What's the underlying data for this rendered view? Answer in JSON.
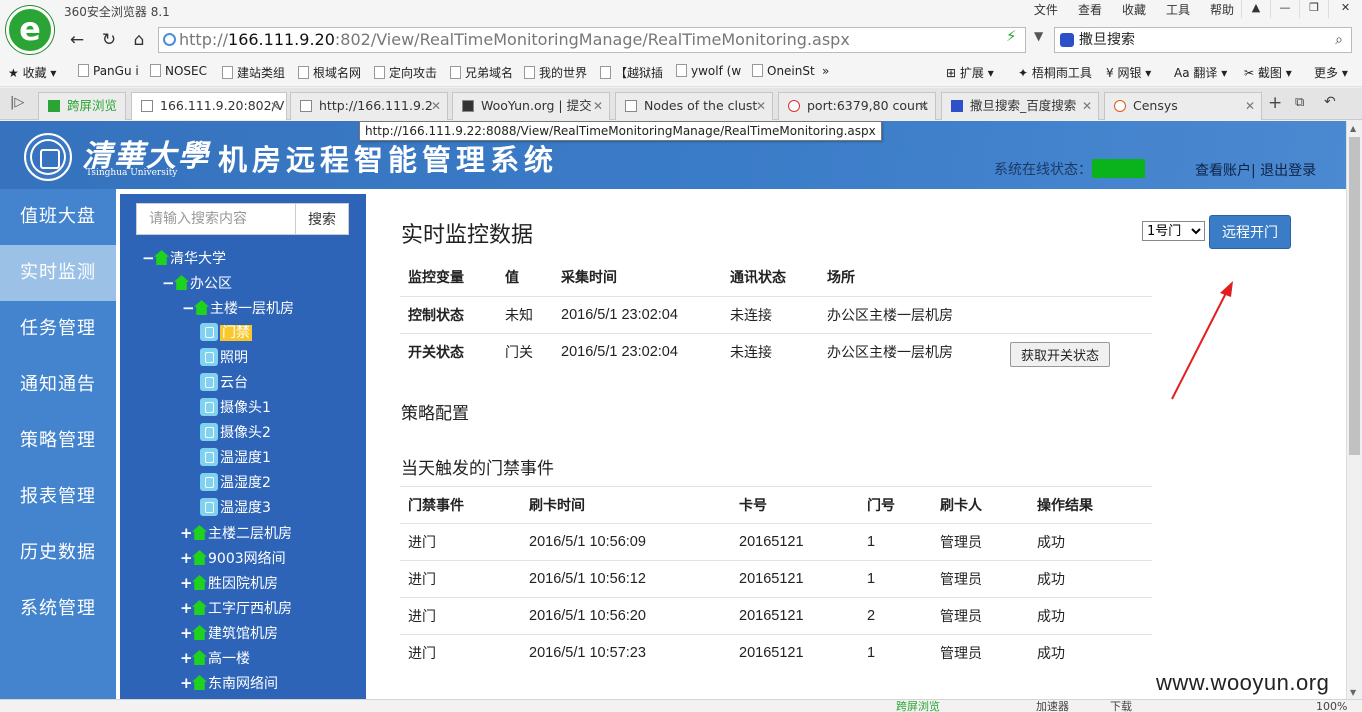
{
  "browser": {
    "app_title": "360安全浏览器 8.1",
    "menu": [
      "文件",
      "查看",
      "收藏",
      "工具",
      "帮助"
    ],
    "address": {
      "prefix": "http://",
      "host": "166.111.9.20",
      "rest": ":802/View/RealTimeMonitoringManage/RealTimeMonitoring.aspx"
    },
    "search_engine_value": "撒旦搜索",
    "bookmarks": [
      "收藏",
      "PanGu i",
      "NOSEC",
      "建站类组",
      "根域名网",
      "定向攻击",
      "兄弟域名",
      "我的世界",
      "【越狱插",
      "ywolf (w",
      "OneinSt",
      "»",
      "扩展",
      "梧桐雨工具",
      "网银",
      "翻译",
      "截图",
      "更多"
    ],
    "tabs": [
      {
        "label": "跨屏浏览"
      },
      {
        "label": "166.111.9.20:802/V"
      },
      {
        "label": "http://166.111.9.2"
      },
      {
        "label": "WooYun.org | 提交"
      },
      {
        "label": "Nodes of the clust"
      },
      {
        "label": "port:6379,80 count"
      },
      {
        "label": "撒旦搜索_百度搜索"
      },
      {
        "label": "Censys"
      }
    ],
    "tooltip": "http://166.111.9.22:8088/View/RealTimeMonitoringManage/RealTimeMonitoring.aspx",
    "status": [
      "跨屏浏览",
      "加速器",
      "下载",
      "100%"
    ]
  },
  "header": {
    "university_cn": "清華大學",
    "university_en": "Tsinghua University",
    "system_title": "机房远程智能管理系统",
    "online_label": "系统在线状态：",
    "online_color": "#0ab21c",
    "account_links": "查看账户| 退出登录"
  },
  "leftnav": {
    "items": [
      "值班大盘",
      "实时监测",
      "任务管理",
      "通知通告",
      "策略管理",
      "报表管理",
      "历史数据",
      "系统管理"
    ],
    "active_index": 1
  },
  "tree": {
    "search_placeholder": "请输入搜索内容",
    "search_button": "搜索",
    "nodes": [
      {
        "toggle": "−",
        "label": "清华大学"
      },
      {
        "toggle": "−",
        "label": "办公区"
      },
      {
        "toggle": "−",
        "label": "主楼一层机房"
      },
      {
        "label": "门禁",
        "selected": true
      },
      {
        "label": "照明"
      },
      {
        "label": "云台"
      },
      {
        "label": "摄像头1"
      },
      {
        "label": "摄像头2"
      },
      {
        "label": "温湿度1"
      },
      {
        "label": "温湿度2"
      },
      {
        "label": "温湿度3"
      },
      {
        "toggle": "+",
        "label": "主楼二层机房"
      },
      {
        "toggle": "+",
        "label": "9003网络间"
      },
      {
        "toggle": "+",
        "label": "胜因院机房"
      },
      {
        "toggle": "+",
        "label": "工字厅西机房"
      },
      {
        "toggle": "+",
        "label": "建筑馆机房"
      },
      {
        "toggle": "+",
        "label": "高一楼"
      },
      {
        "toggle": "+",
        "label": "东南网络间"
      }
    ]
  },
  "realtime": {
    "title": "实时监控数据",
    "door_select": "1号门",
    "remote_open_button": "远程开门",
    "columns": [
      "监控变量",
      "值",
      "采集时间",
      "通讯状态",
      "场所"
    ],
    "rows": [
      [
        "控制状态",
        "未知",
        "2016/5/1 23:02:04",
        "未连接",
        "办公区主楼一层机房"
      ],
      [
        "开关状态",
        "门关",
        "2016/5/1 23:02:04",
        "未连接",
        "办公区主楼一层机房"
      ]
    ],
    "get_status_button": "获取开关状态"
  },
  "strategy": {
    "title": "策略配置"
  },
  "events": {
    "title": "当天触发的门禁事件",
    "columns": [
      "门禁事件",
      "刷卡时间",
      "卡号",
      "门号",
      "刷卡人",
      "操作结果"
    ],
    "rows": [
      [
        "进门",
        "2016/5/1 10:56:09",
        "20165121",
        "1",
        "管理员",
        "成功"
      ],
      [
        "进门",
        "2016/5/1 10:56:12",
        "20165121",
        "1",
        "管理员",
        "成功"
      ],
      [
        "进门",
        "2016/5/1 10:56:20",
        "20165121",
        "2",
        "管理员",
        "成功"
      ],
      [
        "进门",
        "2016/5/1 10:57:23",
        "20165121",
        "1",
        "管理员",
        "成功"
      ]
    ]
  },
  "watermark": "www.wooyun.org",
  "annotation_color": "#e02020"
}
